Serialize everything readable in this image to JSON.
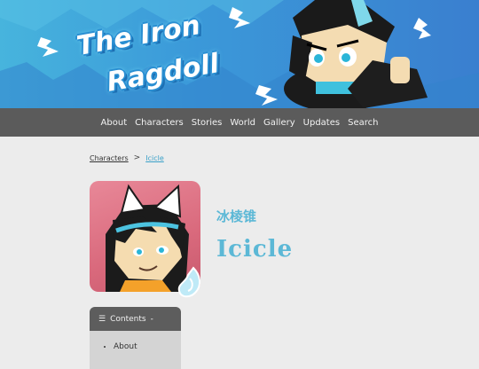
{
  "banner": {
    "title_line1": "The Iron",
    "title_line2": "Ragdoll"
  },
  "nav": {
    "items": [
      "About",
      "Characters",
      "Stories",
      "World",
      "Gallery",
      "Updates",
      "Search"
    ]
  },
  "breadcrumb": {
    "parent": "Characters",
    "separator": ">",
    "current": "Icicle"
  },
  "character": {
    "name_cn": "冰棱锥",
    "name_en": "Icicle"
  },
  "contents": {
    "title": "Contents",
    "toggle": "-",
    "items": [
      "About"
    ]
  },
  "colors": {
    "accent": "#5cb8d6",
    "nav_bg": "#5b5b5b",
    "page_bg": "#ececec",
    "avatar_bg": "#e88898"
  }
}
